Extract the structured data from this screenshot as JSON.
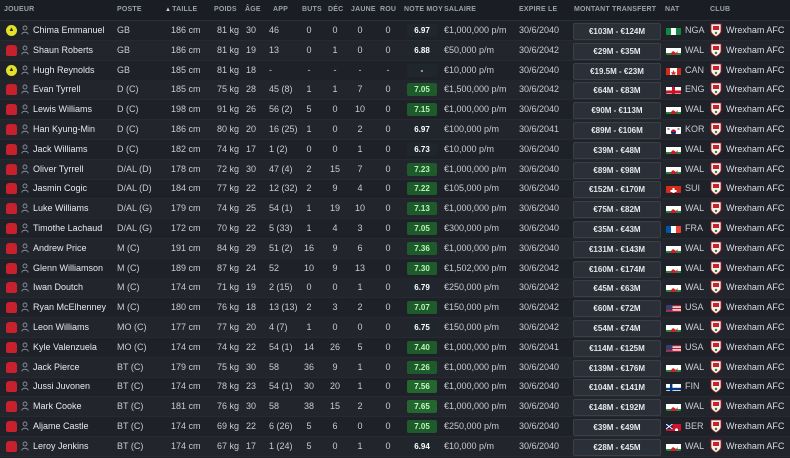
{
  "headers": {
    "joueur": "JOUEUR",
    "poste": "POSTE",
    "taille": "TAILLE",
    "poids": "POIDS",
    "age": "ÂGE",
    "app": "APP",
    "buts": "BUTS",
    "dec": "DÉC",
    "jaune": "JAUNE",
    "rou": "ROU",
    "note": "NOTE MOY",
    "salaire": "SALAIRE",
    "expire": "EXPIRE LE",
    "montant": "MONTANT TRANSFERT",
    "nat": "NAT",
    "club": "CLUB"
  },
  "sort_indicator": "▲",
  "colors": {
    "rating_green": "#1f5a2c",
    "shirt_red": "#c8202c",
    "gk_yellow": "#e3e02a"
  },
  "players": [
    {
      "name": "Chima Emmanuel",
      "pos": "GB",
      "height": "186 cm",
      "weight": "81 kg",
      "age": "30",
      "app": "46",
      "goals": "0",
      "assists": "0",
      "yellow": "0",
      "red": "0",
      "rating": "6.97",
      "salary": "€1,000,000 p/m",
      "expires": "30/6/2040",
      "value": "€103M - €124M",
      "nat": "NGA",
      "flag": "nga",
      "club": "Wrexham AFC",
      "status": "gk",
      "status_icon": "gk-shirt-icon"
    },
    {
      "name": "Shaun Roberts",
      "pos": "GB",
      "height": "186 cm",
      "weight": "81 kg",
      "age": "19",
      "app": "13",
      "goals": "0",
      "assists": "1",
      "yellow": "0",
      "red": "0",
      "rating": "6.88",
      "salary": "€50,000 p/m",
      "expires": "30/6/2042",
      "value": "€29M - €35M",
      "nat": "WAL",
      "flag": "wal",
      "club": "Wrexham AFC",
      "status": "none",
      "status_icon": "player-shirt-icon"
    },
    {
      "name": "Hugh Reynolds",
      "pos": "GB",
      "height": "185 cm",
      "weight": "81 kg",
      "age": "18",
      "app": "-",
      "goals": "-",
      "assists": "-",
      "yellow": "-",
      "red": "-",
      "rating": "-",
      "salary": "€10,000 p/m",
      "expires": "30/6/2040",
      "value": "€19.5M - €23M",
      "nat": "CAN",
      "flag": "can",
      "club": "Wrexham AFC",
      "status": "gk",
      "status_icon": "gk-shirt-icon"
    },
    {
      "name": "Evan Tyrrell",
      "pos": "D (C)",
      "height": "185 cm",
      "weight": "75 kg",
      "age": "28",
      "app": "45 (8)",
      "goals": "1",
      "assists": "1",
      "yellow": "7",
      "red": "0",
      "rating": "7.05",
      "salary": "€1,500,000 p/m",
      "expires": "30/6/2042",
      "value": "€64M - €83M",
      "nat": "ENG",
      "flag": "eng",
      "club": "Wrexham AFC",
      "status": "shirt",
      "status_icon": "player-shirt-icon"
    },
    {
      "name": "Lewis Williams",
      "pos": "D (C)",
      "height": "198 cm",
      "weight": "91 kg",
      "age": "26",
      "app": "56 (2)",
      "goals": "5",
      "assists": "0",
      "yellow": "10",
      "red": "0",
      "rating": "7.15",
      "salary": "€1,000,000 p/m",
      "expires": "30/6/2040",
      "value": "€90M - €113M",
      "nat": "WAL",
      "flag": "wal",
      "club": "Wrexham AFC",
      "status": "shirt",
      "status_icon": "player-shirt-icon"
    },
    {
      "name": "Han Kyung-Min",
      "pos": "D (C)",
      "height": "186 cm",
      "weight": "80 kg",
      "age": "20",
      "app": "16 (25)",
      "goals": "1",
      "assists": "0",
      "yellow": "2",
      "red": "0",
      "rating": "6.97",
      "salary": "€100,000 p/m",
      "expires": "30/6/2041",
      "value": "€89M - €106M",
      "nat": "KOR",
      "flag": "kor",
      "club": "Wrexham AFC",
      "status": "shirt",
      "status_icon": "player-shirt-icon"
    },
    {
      "name": "Jack Williams",
      "pos": "D (C)",
      "height": "182 cm",
      "weight": "74 kg",
      "age": "17",
      "app": "1 (2)",
      "goals": "0",
      "assists": "0",
      "yellow": "1",
      "red": "0",
      "rating": "6.73",
      "salary": "€10,000 p/m",
      "expires": "30/6/2040",
      "value": "€39M - €48M",
      "nat": "WAL",
      "flag": "wal",
      "club": "Wrexham AFC",
      "status": "shirt",
      "status_icon": "player-shirt-icon"
    },
    {
      "name": "Oliver Tyrrell",
      "pos": "D/AL (D)",
      "height": "178 cm",
      "weight": "72 kg",
      "age": "30",
      "app": "47 (4)",
      "goals": "2",
      "assists": "15",
      "yellow": "7",
      "red": "0",
      "rating": "7.23",
      "salary": "€1,000,000 p/m",
      "expires": "30/6/2040",
      "value": "€89M - €98M",
      "nat": "WAL",
      "flag": "wal",
      "club": "Wrexham AFC",
      "status": "shirt",
      "status_icon": "player-shirt-icon"
    },
    {
      "name": "Jasmin Cogic",
      "pos": "D/AL (D)",
      "height": "184 cm",
      "weight": "77 kg",
      "age": "22",
      "app": "12 (32)",
      "goals": "2",
      "assists": "9",
      "yellow": "4",
      "red": "0",
      "rating": "7.22",
      "salary": "€105,000 p/m",
      "expires": "30/6/2040",
      "value": "€152M - €170M",
      "nat": "SUI",
      "flag": "sui",
      "club": "Wrexham AFC",
      "status": "shirt",
      "status_icon": "player-shirt-icon"
    },
    {
      "name": "Luke Williams",
      "pos": "D/AL (G)",
      "height": "179 cm",
      "weight": "74 kg",
      "age": "25",
      "app": "54 (1)",
      "goals": "1",
      "assists": "19",
      "yellow": "10",
      "red": "0",
      "rating": "7.13",
      "salary": "€1,000,000 p/m",
      "expires": "30/6/2040",
      "value": "€75M - €82M",
      "nat": "WAL",
      "flag": "wal",
      "club": "Wrexham AFC",
      "status": "shirt",
      "status_icon": "player-shirt-icon"
    },
    {
      "name": "Timothe Lachaud",
      "pos": "D/AL (G)",
      "height": "172 cm",
      "weight": "70 kg",
      "age": "22",
      "app": "5 (33)",
      "goals": "1",
      "assists": "4",
      "yellow": "3",
      "red": "0",
      "rating": "7.05",
      "salary": "€300,000 p/m",
      "expires": "30/6/2040",
      "value": "€35M - €43M",
      "nat": "FRA",
      "flag": "fra",
      "club": "Wrexham AFC",
      "status": "shirt",
      "status_icon": "player-shirt-icon"
    },
    {
      "name": "Andrew Price",
      "pos": "M (C)",
      "height": "191 cm",
      "weight": "84 kg",
      "age": "29",
      "app": "51 (2)",
      "goals": "16",
      "assists": "9",
      "yellow": "6",
      "red": "0",
      "rating": "7.36",
      "salary": "€1,000,000 p/m",
      "expires": "30/6/2040",
      "value": "€131M - €143M",
      "nat": "WAL",
      "flag": "wal",
      "club": "Wrexham AFC",
      "status": "shirt",
      "status_icon": "player-shirt-icon"
    },
    {
      "name": "Glenn Williamson",
      "pos": "M (C)",
      "height": "189 cm",
      "weight": "87 kg",
      "age": "24",
      "app": "52",
      "goals": "10",
      "assists": "9",
      "yellow": "13",
      "red": "0",
      "rating": "7.30",
      "salary": "€1,502,000 p/m",
      "expires": "30/6/2042",
      "value": "€160M - €174M",
      "nat": "WAL",
      "flag": "wal",
      "club": "Wrexham AFC",
      "status": "shirt",
      "status_icon": "player-shirt-icon"
    },
    {
      "name": "Iwan Doutch",
      "pos": "M (C)",
      "height": "174 cm",
      "weight": "71 kg",
      "age": "19",
      "app": "2 (15)",
      "goals": "0",
      "assists": "0",
      "yellow": "1",
      "red": "0",
      "rating": "6.79",
      "salary": "€250,000 p/m",
      "expires": "30/6/2042",
      "value": "€45M - €63M",
      "nat": "WAL",
      "flag": "wal",
      "club": "Wrexham AFC",
      "status": "shirt",
      "status_icon": "player-shirt-icon"
    },
    {
      "name": "Ryan McElhenney",
      "pos": "M (C)",
      "height": "180 cm",
      "weight": "76 kg",
      "age": "18",
      "app": "13 (13)",
      "goals": "2",
      "assists": "3",
      "yellow": "2",
      "red": "0",
      "rating": "7.07",
      "salary": "€150,000 p/m",
      "expires": "30/6/2042",
      "value": "€60M - €72M",
      "nat": "USA",
      "flag": "usa",
      "club": "Wrexham AFC",
      "status": "shirt",
      "status_icon": "player-shirt-icon"
    },
    {
      "name": "Leon Williams",
      "pos": "MO (C)",
      "height": "177 cm",
      "weight": "77 kg",
      "age": "20",
      "app": "4 (7)",
      "goals": "1",
      "assists": "0",
      "yellow": "0",
      "red": "0",
      "rating": "6.75",
      "salary": "€150,000 p/m",
      "expires": "30/6/2042",
      "value": "€54M - €74M",
      "nat": "WAL",
      "flag": "wal",
      "club": "Wrexham AFC",
      "status": "shirt",
      "status_icon": "player-shirt-icon"
    },
    {
      "name": "Kyle Valenzuela",
      "pos": "MO (C)",
      "height": "174 cm",
      "weight": "74 kg",
      "age": "22",
      "app": "54 (1)",
      "goals": "14",
      "assists": "26",
      "yellow": "5",
      "red": "0",
      "rating": "7.40",
      "salary": "€1,000,000 p/m",
      "expires": "30/6/2041",
      "value": "€114M - €125M",
      "nat": "USA",
      "flag": "usa",
      "club": "Wrexham AFC",
      "status": "shirt",
      "status_icon": "player-shirt-icon"
    },
    {
      "name": "Jack Pierce",
      "pos": "BT (C)",
      "height": "179 cm",
      "weight": "75 kg",
      "age": "30",
      "app": "58",
      "goals": "36",
      "assists": "9",
      "yellow": "1",
      "red": "0",
      "rating": "7.26",
      "salary": "€1,000,000 p/m",
      "expires": "30/6/2040",
      "value": "€139M - €176M",
      "nat": "WAL",
      "flag": "wal",
      "club": "Wrexham AFC",
      "status": "shirt",
      "status_icon": "player-shirt-icon"
    },
    {
      "name": "Jussi Juvonen",
      "pos": "BT (C)",
      "height": "174 cm",
      "weight": "78 kg",
      "age": "23",
      "app": "54 (1)",
      "goals": "30",
      "assists": "20",
      "yellow": "1",
      "red": "0",
      "rating": "7.56",
      "salary": "€1,000,000 p/m",
      "expires": "30/6/2040",
      "value": "€104M - €141M",
      "nat": "FIN",
      "flag": "fin",
      "club": "Wrexham AFC",
      "status": "shirt",
      "status_icon": "player-shirt-icon"
    },
    {
      "name": "Mark Cooke",
      "pos": "BT (C)",
      "height": "181 cm",
      "weight": "76 kg",
      "age": "30",
      "app": "58",
      "goals": "38",
      "assists": "15",
      "yellow": "2",
      "red": "0",
      "rating": "7.65",
      "salary": "€1,000,000 p/m",
      "expires": "30/6/2040",
      "value": "€148M - €192M",
      "nat": "WAL",
      "flag": "wal",
      "club": "Wrexham AFC",
      "status": "shirt",
      "status_icon": "player-shirt-icon"
    },
    {
      "name": "Aljame Castle",
      "pos": "BT (C)",
      "height": "174 cm",
      "weight": "69 kg",
      "age": "22",
      "app": "6 (26)",
      "goals": "5",
      "assists": "6",
      "yellow": "0",
      "red": "0",
      "rating": "7.05",
      "salary": "€250,000 p/m",
      "expires": "30/6/2040",
      "value": "€39M - €49M",
      "nat": "BER",
      "flag": "ber",
      "club": "Wrexham AFC",
      "status": "shirt",
      "status_icon": "player-shirt-icon"
    },
    {
      "name": "Leroy Jenkins",
      "pos": "BT (C)",
      "height": "174 cm",
      "weight": "67 kg",
      "age": "17",
      "app": "1 (24)",
      "goals": "5",
      "assists": "0",
      "yellow": "1",
      "red": "0",
      "rating": "6.94",
      "salary": "€10,000 p/m",
      "expires": "30/6/2040",
      "value": "€28M - €45M",
      "nat": "WAL",
      "flag": "wal",
      "club": "Wrexham AFC",
      "status": "shirt",
      "status_icon": "player-shirt-icon"
    }
  ]
}
